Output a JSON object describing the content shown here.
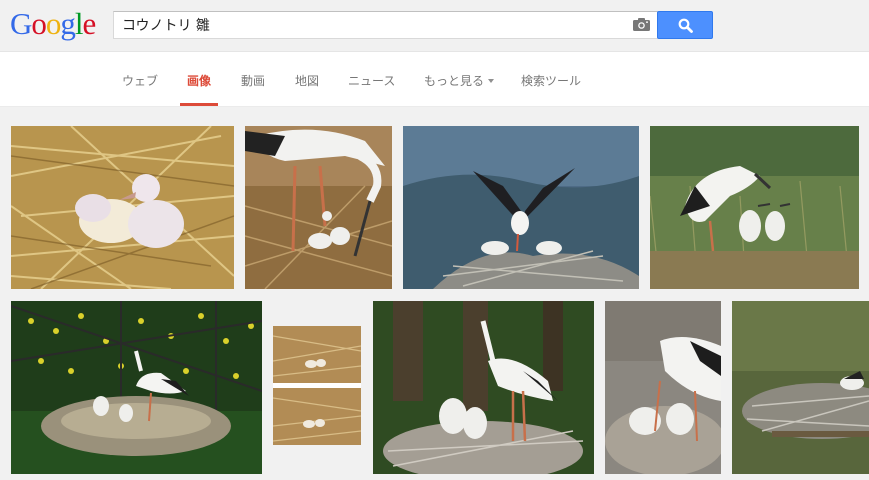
{
  "logo": {
    "letters": [
      "G",
      "o",
      "o",
      "g",
      "l",
      "e"
    ],
    "colors": [
      "#3369e8",
      "#d50f25",
      "#eeb211",
      "#3369e8",
      "#009925",
      "#d50f25"
    ]
  },
  "search": {
    "query": "コウノトリ 雛",
    "camera_icon": "camera-icon",
    "button_icon": "magnifier-icon"
  },
  "tabs": [
    {
      "label": "ウェブ",
      "active": false
    },
    {
      "label": "画像",
      "active": true
    },
    {
      "label": "動画",
      "active": false
    },
    {
      "label": "地図",
      "active": false
    },
    {
      "label": "ニュース",
      "active": false
    },
    {
      "label": "もっと見る",
      "active": false,
      "dropdown": true
    },
    {
      "label": "検索ツール",
      "active": false
    }
  ],
  "colors": {
    "accent": "#dd4b39",
    "search_button": "#4d90fe"
  },
  "results": [
    {
      "scene": "stork chicks on straw nest"
    },
    {
      "scene": "adult stork feeding chicks"
    },
    {
      "scene": "stork spreading wings above nest"
    },
    {
      "scene": "adult and chicks in grass"
    },
    {
      "scene": "stork on nest platform"
    },
    {
      "scene": "small chicks on nest, two frames"
    },
    {
      "scene": "adult with two chicks on nest"
    },
    {
      "scene": "adults with chicks close-up"
    },
    {
      "scene": "nest with chick"
    }
  ]
}
